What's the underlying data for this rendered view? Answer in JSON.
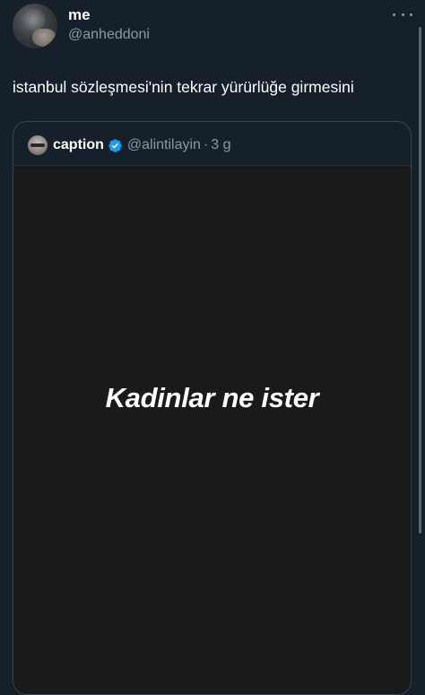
{
  "tweet": {
    "author": {
      "display_name": "me",
      "handle": "@anheddoni"
    },
    "text": "istanbul sözleşmesi'nin tekrar yürürlüğe girmesini",
    "more_icon": "more-horizontal-icon"
  },
  "quoted_tweet": {
    "author": {
      "display_name": "caption",
      "handle": "@alintilayin",
      "verified_icon": "verified-badge-icon",
      "verified_color": "#1d9bf0"
    },
    "separator": "·",
    "time": "3 g",
    "media": {
      "caption": "Kadinlar ne ister",
      "background": "#1a1a1a"
    }
  },
  "colors": {
    "background": "#15202b",
    "secondary_text": "#8b98a5",
    "border": "#38444d"
  }
}
